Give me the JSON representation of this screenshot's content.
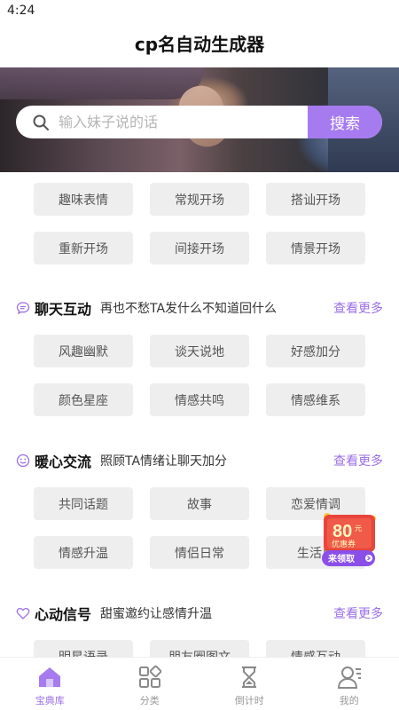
{
  "status_bar": {
    "time": "4:24"
  },
  "app": {
    "title": "cp名自动生成器"
  },
  "search": {
    "placeholder": "输入妹子说的话",
    "button_label": "搜索"
  },
  "quick_chips": [
    "趣味表情",
    "常规开场",
    "搭讪开场",
    "重新开场",
    "间接开场",
    "情景开场"
  ],
  "sections": [
    {
      "title": "聊天互动",
      "subtitle": "再也不愁TA发什么不知道回什么",
      "more": "查看更多",
      "icon": "chat-bubble-icon",
      "chips": [
        "风趣幽默",
        "谈天说地",
        "好感加分",
        "颜色星座",
        "情感共鸣",
        "情感维系"
      ]
    },
    {
      "title": "暖心交流",
      "subtitle": "照顾TA情绪让聊天加分",
      "more": "查看更多",
      "icon": "smile-icon",
      "chips": [
        "共同话题",
        "故事",
        "恋爱情调",
        "情感升温",
        "情侣日常",
        "生活日"
      ]
    },
    {
      "title": "心动信号",
      "subtitle": "甜蜜邀约让感情升温",
      "more": "查看更多",
      "icon": "heart-icon",
      "chips": [
        "明星语录",
        "朋友圈图文",
        "情感互动"
      ]
    }
  ],
  "promo": {
    "amount": "80",
    "unit": "元",
    "label": "优惠券",
    "cta": "来领取"
  },
  "tabs": [
    {
      "label": "宝典库",
      "icon": "home-icon",
      "active": true
    },
    {
      "label": "分类",
      "icon": "category-icon",
      "active": false
    },
    {
      "label": "倒计时",
      "icon": "hourglass-icon",
      "active": false
    },
    {
      "label": "我的",
      "icon": "profile-icon",
      "active": false
    }
  ],
  "colors": {
    "accent": "#a77bf0",
    "link": "#9b6ee6",
    "chip_bg": "#eeeeee",
    "promo_red": "#e8453c"
  }
}
